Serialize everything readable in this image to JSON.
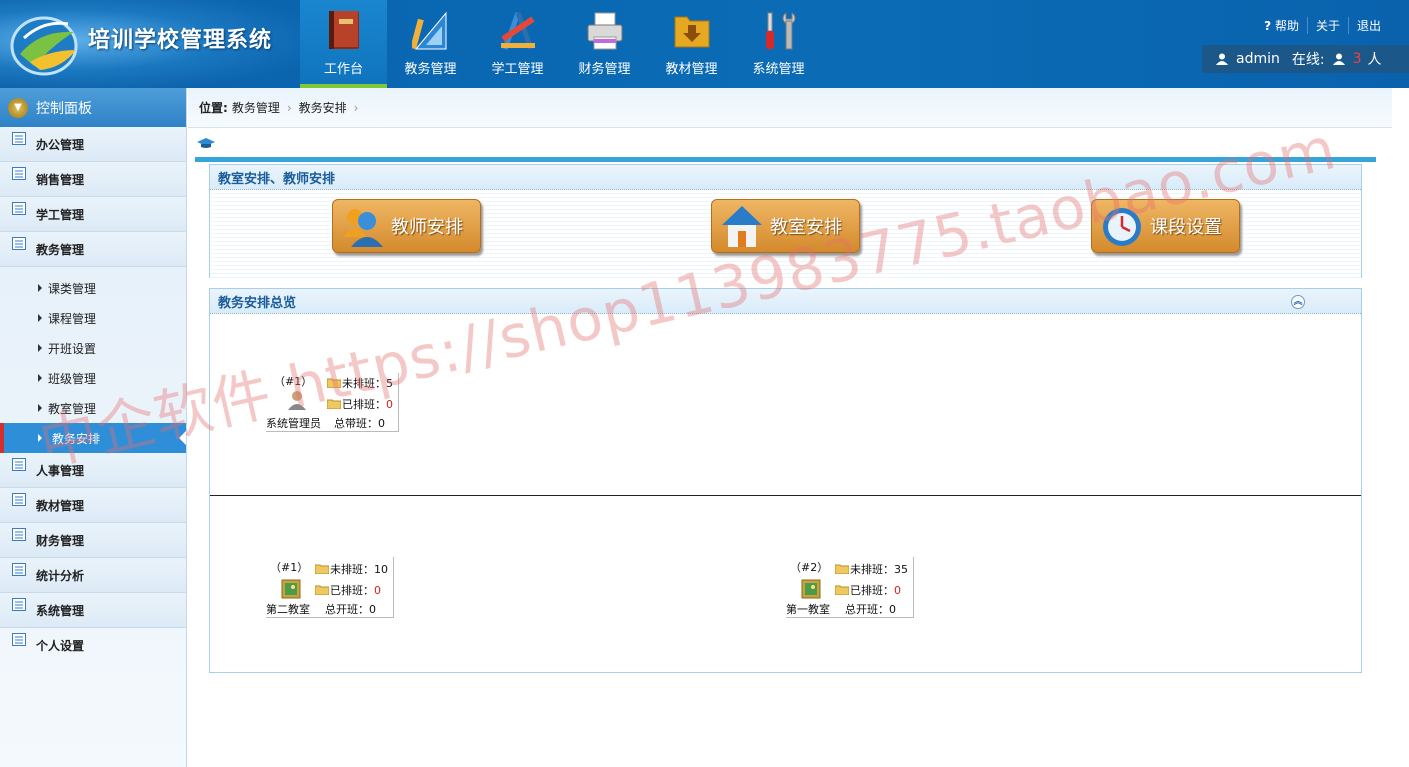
{
  "app": {
    "title": "培训学校管理系统"
  },
  "topnav": [
    {
      "label": "工作台",
      "icon": "book-icon",
      "active": true
    },
    {
      "label": "教务管理",
      "icon": "ruler-triangle-icon"
    },
    {
      "label": "学工管理",
      "icon": "compass-pencil-icon"
    },
    {
      "label": "财务管理",
      "icon": "printer-icon"
    },
    {
      "label": "教材管理",
      "icon": "folder-download-icon"
    },
    {
      "label": "系统管理",
      "icon": "tools-icon"
    }
  ],
  "toplinks": {
    "help": "帮助",
    "about": "关于",
    "logout": "退出"
  },
  "user": {
    "name": "admin",
    "online_label": "在线:",
    "online_count": "3",
    "unit": "人"
  },
  "sidebar": {
    "head": "控制面板",
    "items_before": [
      "办公管理",
      "销售管理",
      "学工管理",
      "教务管理"
    ],
    "sub_items": [
      "课类管理",
      "课程管理",
      "开班设置",
      "班级管理",
      "教室管理",
      "教务安排"
    ],
    "active_sub": "教务安排",
    "items_after": [
      "人事管理",
      "教材管理",
      "财务管理",
      "统计分析",
      "系统管理",
      "个人设置"
    ]
  },
  "breadcrumb": {
    "label": "位置:",
    "level1": "教务管理",
    "level2": "教务安排",
    "sep": "›"
  },
  "panel1": {
    "title": "教室安排、教师安排",
    "buttons": {
      "teacher": "教师安排",
      "classroom": "教室安排",
      "period": "课段设置"
    }
  },
  "panel2": {
    "title": "教务安排总览",
    "teacher_card": {
      "tag": "（#1）",
      "unscheduled_label": "未排班：",
      "unscheduled": "5",
      "scheduled_label": "已排班：",
      "scheduled": "0",
      "name": "系统管理员",
      "total_label": "总带班：",
      "total": "0"
    },
    "room_cards": [
      {
        "tag": "（#1）",
        "unscheduled_label": "未排班：",
        "unscheduled": "10",
        "scheduled_label": "已排班：",
        "scheduled": "0",
        "name": "第二教室",
        "total_label": "总开班：",
        "total": "0"
      },
      {
        "tag": "（#2）",
        "unscheduled_label": "未排班：",
        "unscheduled": "35",
        "scheduled_label": "已排班：",
        "scheduled": "0",
        "name": "第一教室",
        "total_label": "总开班：",
        "total": "0"
      }
    ]
  },
  "watermark": "中企软件 https://shop113983775.taobao.com",
  "colors": {
    "header": "#0a67b2",
    "accent": "#36a3d9",
    "active_nav_border": "#7ec83a",
    "button": "#d48a2c",
    "red": "#d02020"
  }
}
